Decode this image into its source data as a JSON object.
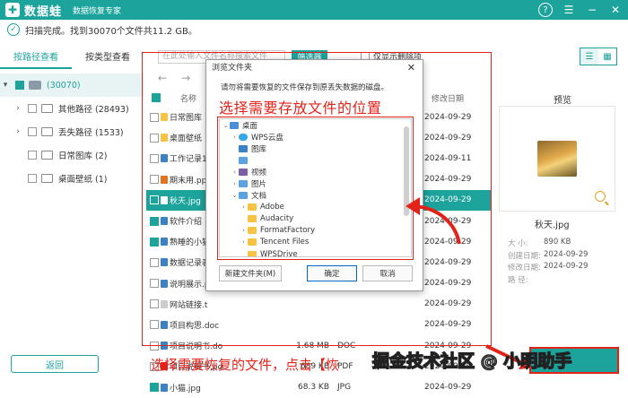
{
  "app": {
    "name": "数据蛙",
    "subtitle": "数据恢复专家"
  },
  "status": {
    "text": "扫描完成。找到30070个文件共11.2 GB。"
  },
  "tabs": [
    "按路径查看",
    "按类型查看"
  ],
  "tree": {
    "root": {
      "label": "(30070)"
    },
    "items": [
      {
        "label": "其他路径 (28493)",
        "expand": true
      },
      {
        "label": "丢失路径 (1533)",
        "expand": true
      },
      {
        "label": "日常图库 (2)",
        "expand": false
      },
      {
        "label": "桌面壁纸 (1)",
        "expand": false
      }
    ]
  },
  "toolbar": {
    "search_placeholder": "在此处输入文件名称搜索文件",
    "filter": "筛选器",
    "only_deleted": "仅显示删除项"
  },
  "columns": {
    "name": "名称",
    "date": "修改日期"
  },
  "files": [
    {
      "name": "日常图库",
      "size": "",
      "type": "",
      "date": "2024-09-29",
      "icon": "#f6c342",
      "checked": false,
      "selected": false
    },
    {
      "name": "桌面壁纸",
      "size": "",
      "type": "",
      "date": "2024-09-29",
      "icon": "#f6c342",
      "checked": false,
      "selected": false
    },
    {
      "name": "工作记录1",
      "size": "",
      "type": "",
      "date": "2024-09-11",
      "icon": "#3b82c4",
      "checked": false,
      "selected": false
    },
    {
      "name": "期末用.ppt",
      "size": "",
      "type": "",
      "date": "2024-09-29",
      "icon": "#e2731a",
      "checked": false,
      "selected": false
    },
    {
      "name": "秋天.jpg",
      "size": "",
      "type": "",
      "date": "2024-09-29",
      "icon": "#ffffff",
      "checked": true,
      "selected": true
    },
    {
      "name": "软件介绍",
      "size": "",
      "type": "",
      "date": "2024-09-29",
      "icon": "#3b82c4",
      "checked": true,
      "selected": false
    },
    {
      "name": "熟睡的小猫",
      "size": "",
      "type": "",
      "date": "2024-09-29",
      "icon": "#3b82c4",
      "checked": true,
      "selected": false
    },
    {
      "name": "数据记录表",
      "size": "",
      "type": "",
      "date": "2024-09-29",
      "icon": "#3b82c4",
      "checked": false,
      "selected": false
    },
    {
      "name": "说明展示.p",
      "size": "",
      "type": "",
      "date": "2024-09-29",
      "icon": "#3b82c4",
      "checked": false,
      "selected": false
    },
    {
      "name": "网站链接.t",
      "size": "",
      "type": "",
      "date": "2024-09-29",
      "icon": "#cccccc",
      "checked": false,
      "selected": false
    },
    {
      "name": "项目构思.doc",
      "size": "",
      "type": "",
      "date": "2024-09-29",
      "icon": "#3b82c4",
      "checked": false,
      "selected": false
    },
    {
      "name": "项目说明书.do...",
      "size": "1.68 MB",
      "type": "DOC",
      "date": "2024-09-29",
      "icon": "#3b82c4",
      "checked": false,
      "selected": false
    },
    {
      "name": "项目说明书.pdf",
      "size": "689 KB",
      "type": "PDF",
      "date": "2024-09-29",
      "icon": "#e2231a",
      "checked": false,
      "selected": false
    },
    {
      "name": "小猫.jpg",
      "size": "68.3 KB",
      "type": "JPG",
      "date": "2024-09-29",
      "icon": "#3b82c4",
      "checked": true,
      "selected": false
    }
  ],
  "preview": {
    "title": "预览",
    "file_name": "秋天.jpg",
    "meta": [
      {
        "k": "大 小:",
        "v": "890 KB"
      },
      {
        "k": "创建日期:",
        "v": "2024-09-29"
      },
      {
        "k": "修改日期:",
        "v": "2024-09-29"
      },
      {
        "k": "路 径:",
        "v": ""
      }
    ]
  },
  "dialog": {
    "title": "浏览文件夹",
    "description": "请勿将需要恢复的文件保存到原丢失数据的磁盘。",
    "annotation": "选择需要存放文件的位置",
    "folders": [
      {
        "label": "桌面",
        "indent": 0,
        "icon": "pc",
        "arrow": "⌄"
      },
      {
        "label": "WPS云盘",
        "indent": 1,
        "icon": "cloud",
        "arrow": "›"
      },
      {
        "label": "图库",
        "indent": 1,
        "icon": "b",
        "arrow": ""
      },
      {
        "label": "",
        "indent": 1,
        "icon": "c",
        "arrow": ""
      },
      {
        "label": "视频",
        "indent": 1,
        "icon": "p",
        "arrow": "›"
      },
      {
        "label": "图片",
        "indent": 1,
        "icon": "c",
        "arrow": "›"
      },
      {
        "label": "文档",
        "indent": 1,
        "icon": "c",
        "arrow": "⌄"
      },
      {
        "label": "Adobe",
        "indent": 2,
        "icon": "y",
        "arrow": "›"
      },
      {
        "label": "Audacity",
        "indent": 2,
        "icon": "y",
        "arrow": ""
      },
      {
        "label": "FormatFactory",
        "indent": 2,
        "icon": "y",
        "arrow": "›"
      },
      {
        "label": "Tencent Files",
        "indent": 2,
        "icon": "y",
        "arrow": "›"
      },
      {
        "label": "WPSDrive",
        "indent": 2,
        "icon": "y",
        "arrow": ""
      }
    ],
    "new_folder": "新建文件夹(M)",
    "ok": "确定",
    "cancel": "取消"
  },
  "footer": {
    "back": "返回",
    "annotation": "选择需要恢复的文件，点击【恢",
    "watermark": "掘金技术社区 @ 小明助手"
  }
}
